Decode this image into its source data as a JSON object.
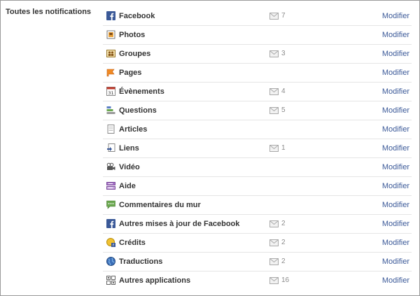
{
  "section": {
    "title": "Toutes les notifications"
  },
  "colors": {
    "link": "#3b5998",
    "facebook_blue": "#3b5998",
    "divider": "#e5e5e5"
  },
  "rows": [
    {
      "label": "Facebook",
      "icon": "facebook-icon",
      "count": "7",
      "action": "Modifier"
    },
    {
      "label": "Photos",
      "icon": "photos-icon",
      "count": "",
      "action": "Modifier"
    },
    {
      "label": "Groupes",
      "icon": "groups-icon",
      "count": "3",
      "action": "Modifier"
    },
    {
      "label": "Pages",
      "icon": "pages-flag-icon",
      "count": "",
      "action": "Modifier"
    },
    {
      "label": "Évènements",
      "icon": "calendar-icon",
      "count": "4",
      "action": "Modifier"
    },
    {
      "label": "Questions",
      "icon": "questions-icon",
      "count": "5",
      "action": "Modifier"
    },
    {
      "label": "Articles",
      "icon": "notes-icon",
      "count": "",
      "action": "Modifier"
    },
    {
      "label": "Liens",
      "icon": "link-icon",
      "count": "1",
      "action": "Modifier"
    },
    {
      "label": "Vidéo",
      "icon": "video-camera-icon",
      "count": "",
      "action": "Modifier"
    },
    {
      "label": "Aide",
      "icon": "help-icon",
      "count": "",
      "action": "Modifier"
    },
    {
      "label": "Commentaires du mur",
      "icon": "wall-comment-icon",
      "count": "",
      "action": "Modifier"
    },
    {
      "label": "Autres mises à jour de Facebook",
      "icon": "facebook-icon",
      "count": "2",
      "action": "Modifier"
    },
    {
      "label": "Crédits",
      "icon": "credits-icon",
      "count": "2",
      "action": "Modifier"
    },
    {
      "label": "Traductions",
      "icon": "globe-icon",
      "count": "2",
      "action": "Modifier"
    },
    {
      "label": "Autres applications",
      "icon": "apps-icon",
      "count": "16",
      "action": "Modifier"
    }
  ]
}
